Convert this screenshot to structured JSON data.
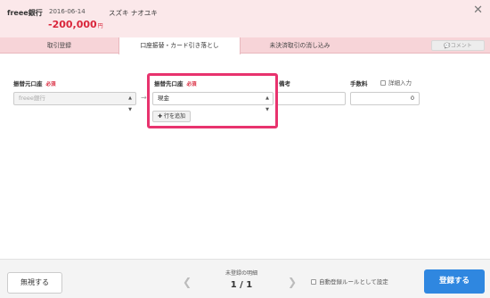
{
  "header": {
    "bank_name": "freee銀行",
    "date": "2016-06-14",
    "person": "スズキ ナオユキ",
    "amount": "-200,000",
    "currency": "円",
    "close_icon": "close-icon"
  },
  "tabs": [
    {
      "label": "取引登録",
      "active": false
    },
    {
      "label": "口座振替・カード引き落とし",
      "active": true
    },
    {
      "label": "未決済取引の消し込み",
      "active": false
    }
  ],
  "comment_button": "コメント",
  "form": {
    "source": {
      "label": "振替元口座",
      "required": "必須",
      "value": "freee銀行"
    },
    "destination": {
      "label": "振替先口座",
      "required": "必須",
      "value": "現金"
    },
    "memo": {
      "label": "備考",
      "value": ""
    },
    "fee": {
      "label": "手数料",
      "value": "0"
    },
    "detail_input": "詳細入力",
    "add_row": "行を追加"
  },
  "footer": {
    "ignore_button": "無視する",
    "unregistered_label": "未登録の明細",
    "page_count": "1 / 1",
    "auto_rule": "自動登録ルールとして設定",
    "register_button": "登録する"
  },
  "colors": {
    "accent_red": "#d9263b",
    "highlight_pink": "#e8336e",
    "primary_blue": "#2f87e0",
    "header_pink": "#fbe8ea"
  }
}
